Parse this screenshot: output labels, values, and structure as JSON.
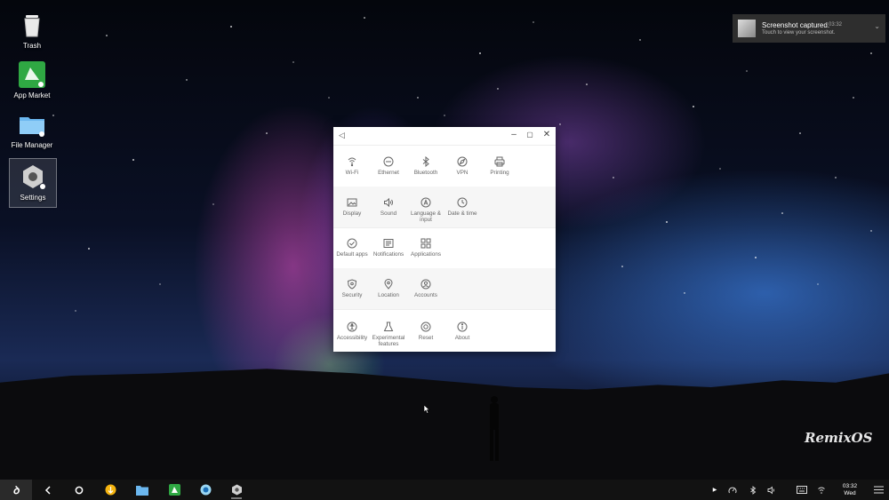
{
  "desktop": {
    "icons": [
      {
        "label": "Trash",
        "icon": "trash-icon"
      },
      {
        "label": "App Market",
        "icon": "app-market-icon"
      },
      {
        "label": "File Manager",
        "icon": "folder-icon"
      },
      {
        "label": "Settings",
        "icon": "gear-icon"
      }
    ],
    "watermark": "RemixOS"
  },
  "notification": {
    "title": "Screenshot captured.",
    "time": "03:32",
    "subtitle": "Touch to view your screenshot."
  },
  "settings": {
    "sections": [
      {
        "items": [
          {
            "label": "Wi-Fi",
            "icon": "wifi-icon"
          },
          {
            "label": "Ethernet",
            "icon": "ethernet-icon"
          },
          {
            "label": "Bluetooth",
            "icon": "bluetooth-icon"
          },
          {
            "label": "VPN",
            "icon": "vpn-icon"
          },
          {
            "label": "Printing",
            "icon": "printer-icon"
          }
        ]
      },
      {
        "items": [
          {
            "label": "Display",
            "icon": "display-icon"
          },
          {
            "label": "Sound",
            "icon": "sound-icon"
          },
          {
            "label": "Language & input",
            "icon": "language-icon"
          },
          {
            "label": "Date & time",
            "icon": "clock-icon"
          }
        ]
      },
      {
        "items": [
          {
            "label": "Default apps",
            "icon": "check-circle-icon"
          },
          {
            "label": "Notifications",
            "icon": "notifications-icon"
          },
          {
            "label": "Applications",
            "icon": "grid-icon"
          }
        ]
      },
      {
        "items": [
          {
            "label": "Security",
            "icon": "shield-icon"
          },
          {
            "label": "Location",
            "icon": "location-icon"
          },
          {
            "label": "Accounts",
            "icon": "account-icon"
          }
        ]
      },
      {
        "items": [
          {
            "label": "Accessibility",
            "icon": "accessibility-icon"
          },
          {
            "label": "Experimental features",
            "icon": "flask-icon"
          },
          {
            "label": "Reset",
            "icon": "reset-icon"
          },
          {
            "label": "About",
            "icon": "info-icon"
          }
        ]
      }
    ]
  },
  "taskbar": {
    "clock_time": "03:32",
    "clock_day": "Wed"
  }
}
